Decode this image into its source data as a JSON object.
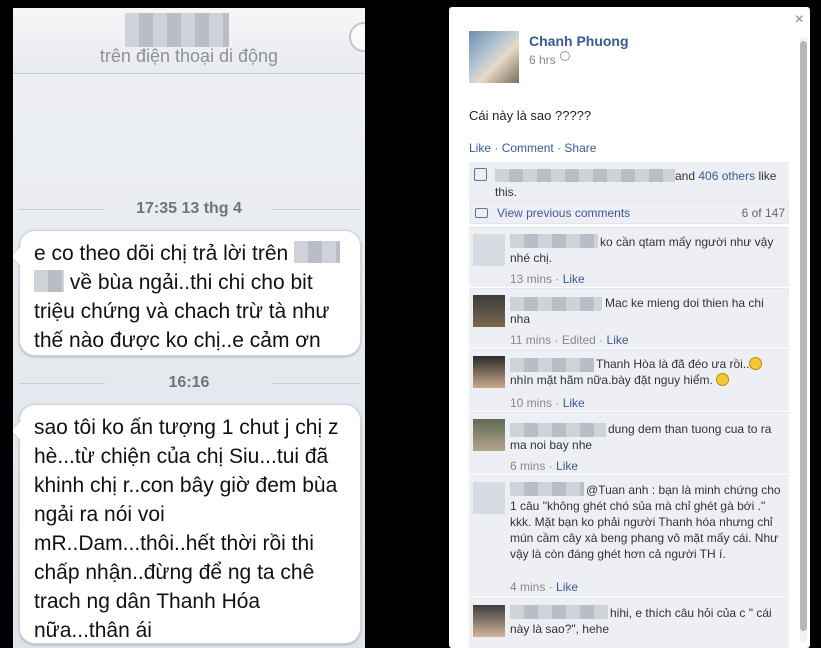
{
  "phone": {
    "subtitle": "trên điện thoại di động",
    "time1": "17:35 13 thg 4",
    "msg1_a": "e co theo dõi chị trả lời trên",
    "msg1_b": "về bùa ngải..thi chi cho bit triệu chứng và chach trừ tà như thế nào được ko chị..e cảm ơn",
    "time2": "16:16",
    "msg2": "sao tôi ko ấn tượng 1 chut j chị z hè...từ chiện của chị Siu...tui đã khinh chị r..con bây giờ đem bùa ngải ra nói voi mR..Dam...thôi..hết thời rồi thi chấp nhận..đừng để ng ta chê trach ng dân Thanh Hóa nữa...thân ái"
  },
  "fb": {
    "close": "×",
    "poster_name": "Chanh Phuong",
    "post_time": "6 hrs",
    "post_text": "Cái này là sao ?????",
    "action_like": "Like",
    "action_comment": "Comment",
    "action_share": "Share",
    "dot": "·",
    "likes_and": "and",
    "likes_others": "406 others",
    "likes_tail": "like this.",
    "prev_comments": "View previous comments",
    "prev_count": "6 of 147",
    "comments": [
      {
        "text": "ko cần qtam mấy người như vậy nhé chị.",
        "time": "13 mins",
        "like": "Like",
        "edited": ""
      },
      {
        "text": "Mac ke mieng doi thien ha chi nha",
        "time": "11 mins",
        "like": "Like",
        "edited": "Edited"
      },
      {
        "text_a": "Thanh Hòa là đã đéo ưa rồi..",
        "text_b": "nhìn mặt hãm nữa.bày đặt nguy hiểm.",
        "time": "10 mins",
        "like": "Like"
      },
      {
        "text": "dung dem than tuong cua to ra ma noi bay nhe",
        "time": "6 mins",
        "like": "Like"
      },
      {
        "text": "@Tuan anh : bạn là minh chứng cho 1 câu \"không ghét chó sủa mà chỉ ghét gà bới .\" kkk. Mặt bạn ko phải người Thanh hóa nhưng chỉ mún cầm cây xà beng phang vô mặt mấy cái. Như vậy là còn đáng ghét hơn cả người TH í.",
        "time": "4 mins",
        "like": "Like"
      },
      {
        "text": "hihi, e thích câu hỏi của c \" cái này là sao?\", hehe"
      }
    ]
  }
}
